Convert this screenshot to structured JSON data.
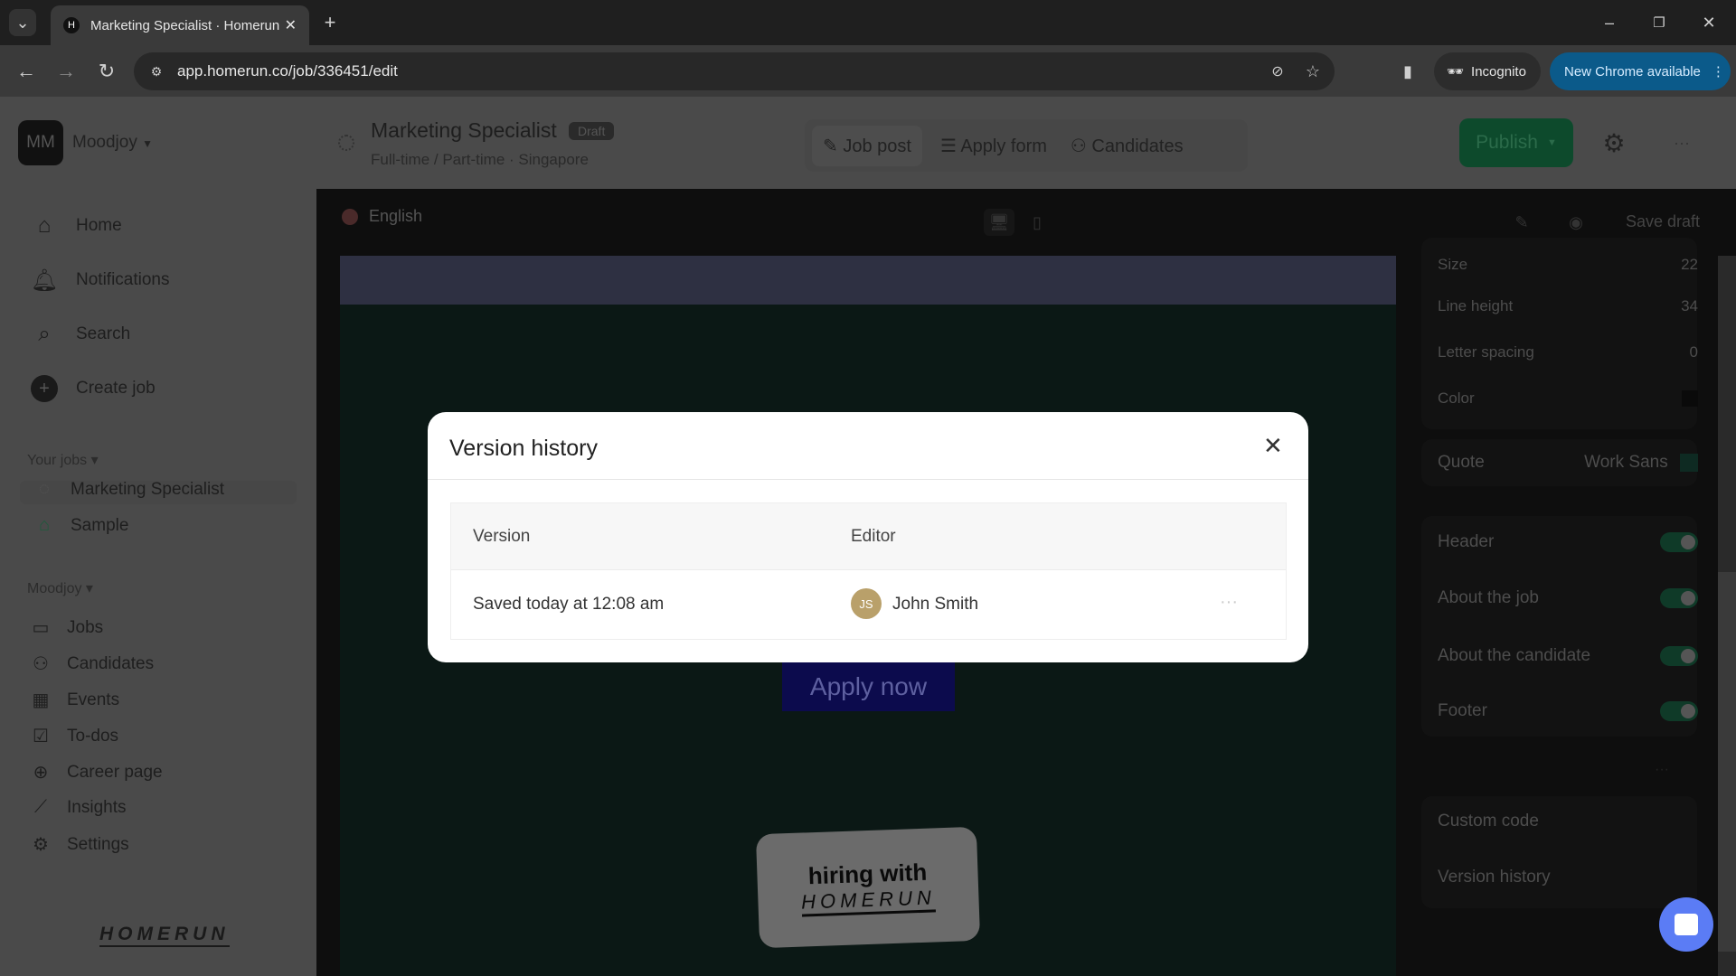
{
  "browser": {
    "tab_title": "Marketing Specialist · Homerun",
    "url": "app.homerun.co/job/336451/edit",
    "incognito_label": "Incognito",
    "update_label": "New Chrome available"
  },
  "workspace": {
    "initials": "MM",
    "name": "Moodjoy"
  },
  "job": {
    "title": "Marketing Specialist",
    "status": "Draft",
    "meta": "Full-time / Part-time · Singapore"
  },
  "header_tabs": [
    {
      "label": "Job post",
      "icon": "pencil-icon"
    },
    {
      "label": "Apply form",
      "icon": "checklist-icon"
    },
    {
      "label": "Candidates",
      "icon": "people-icon"
    }
  ],
  "publish_label": "Publish",
  "sidebar": {
    "main": [
      {
        "label": "Home",
        "icon": "home-icon"
      },
      {
        "label": "Notifications",
        "icon": "bell-icon"
      },
      {
        "label": "Search",
        "icon": "search-icon"
      },
      {
        "label": "Create job",
        "icon": "plus-circle-icon"
      }
    ],
    "your_jobs_label": "Your jobs",
    "jobs": [
      {
        "label": "Marketing Specialist"
      },
      {
        "label": "Sample"
      }
    ],
    "org_label": "Moodjoy",
    "org_items": [
      {
        "label": "Jobs",
        "icon": "jobs-icon"
      },
      {
        "label": "Candidates",
        "icon": "people-icon"
      },
      {
        "label": "Events",
        "icon": "calendar-icon"
      },
      {
        "label": "To-dos",
        "icon": "checkbox-icon"
      },
      {
        "label": "Career page",
        "icon": "globe-icon"
      },
      {
        "label": "Insights",
        "icon": "chart-icon"
      },
      {
        "label": "Settings",
        "icon": "gear-icon"
      }
    ],
    "logo": "HOMERUN"
  },
  "editor": {
    "language": "English",
    "save_draft": "Save draft",
    "apply_now": "Apply now",
    "badge_line1": "hiring with",
    "badge_line2": "HOMERUN"
  },
  "right_panel": {
    "typography": [
      {
        "label": "Size",
        "value": "22"
      },
      {
        "label": "Line height",
        "value": "34"
      },
      {
        "label": "Letter spacing",
        "value": "0"
      },
      {
        "label": "Color",
        "value": ""
      }
    ],
    "quote": {
      "label": "Quote",
      "font": "Work Sans"
    },
    "sections": [
      {
        "label": "Header",
        "on": true
      },
      {
        "label": "About the job",
        "on": true
      },
      {
        "label": "About the candidate",
        "on": true
      },
      {
        "label": "Footer",
        "on": true
      }
    ],
    "links": [
      "Custom code",
      "Version history"
    ]
  },
  "modal": {
    "title": "Version history",
    "columns": [
      "Version",
      "Editor"
    ],
    "rows": [
      {
        "version": "Saved today at 12:08 am",
        "editor_initials": "JS",
        "editor": "John Smith"
      }
    ]
  },
  "colors": {
    "publish": "#0d4a2c",
    "avatar": "#b9a06a",
    "chat": "#5b7cf5",
    "update_pill": "#0b5a8a"
  }
}
